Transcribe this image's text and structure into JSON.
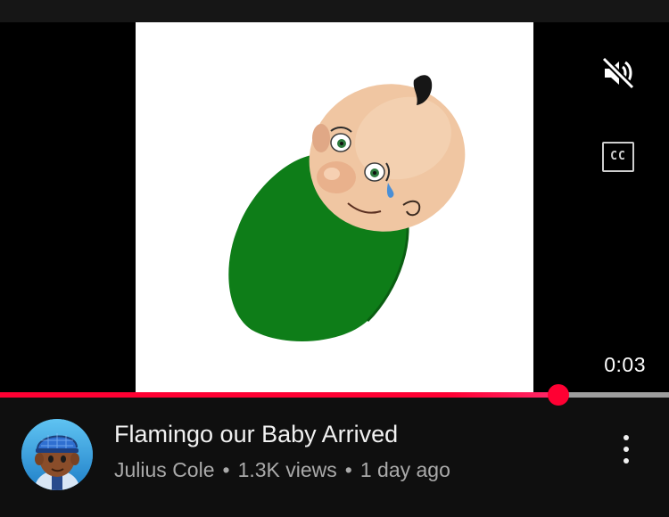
{
  "player": {
    "time_current": "0:03",
    "progress_fraction": 0.835,
    "muted": true,
    "captions_label": "CC",
    "icons": {
      "mute": "volume-muted-icon",
      "captions": "closed-captions-icon"
    }
  },
  "video": {
    "title": "Flamingo our Baby Arrived",
    "channel": "Julius Cole",
    "views": "1.3K views",
    "age": "1 day ago",
    "separator": "•",
    "more_icon": "more-vert-icon"
  },
  "colors": {
    "background": "#0f0f0f",
    "progress_played": "#ff0033",
    "progress_remaining": "#9e9e9e",
    "title_text": "#f1f1f1",
    "meta_text": "#aaaaaa"
  }
}
